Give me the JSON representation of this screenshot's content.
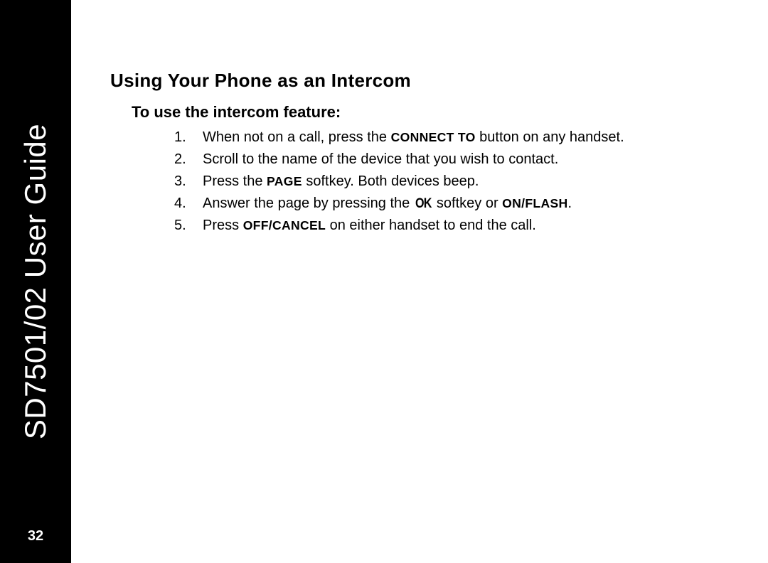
{
  "sidebar": {
    "title": "SD7501/02 User Guide",
    "page_number": "32"
  },
  "content": {
    "heading": "Using Your Phone as an Intercom",
    "subheading": "To use the intercom feature:",
    "steps": [
      {
        "num": "1.",
        "pre": "When not on a call, press the ",
        "bold1": "CONNECT TO",
        "post": " button on any handset."
      },
      {
        "num": "2.",
        "pre": "Scroll to the name of the device that you wish to contact.",
        "bold1": "",
        "post": ""
      },
      {
        "num": "3.",
        "pre": "Press the ",
        "bold1": "PAGE",
        "post": " softkey. Both devices beep."
      },
      {
        "num": "4.",
        "pre": "Answer the page by pressing the ",
        "ok_icon": "OK",
        "mid": " softkey or ",
        "bold1": "ON/FLASH",
        "post": "."
      },
      {
        "num": "5.",
        "pre": "Press ",
        "bold1": "OFF/CANCEL",
        "post": " on either handset to end the call."
      }
    ]
  }
}
